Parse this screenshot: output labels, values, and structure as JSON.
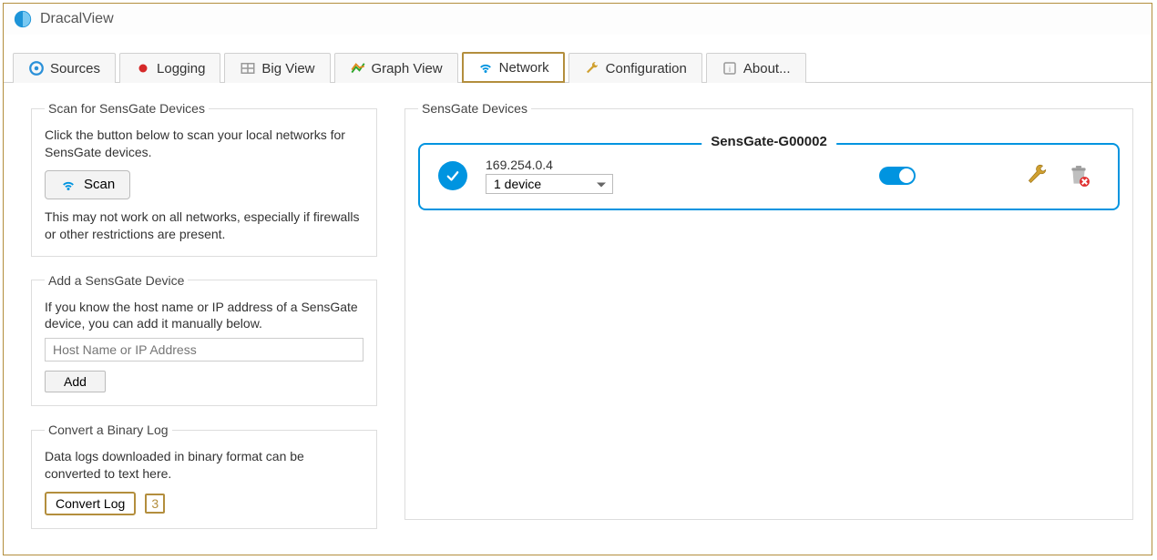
{
  "window": {
    "title": "DracalView"
  },
  "tabs": [
    {
      "label": "Sources",
      "icon": "gear-icon",
      "active": false
    },
    {
      "label": "Logging",
      "icon": "record-icon",
      "active": false
    },
    {
      "label": "Big View",
      "icon": "grid-icon",
      "active": false
    },
    {
      "label": "Graph View",
      "icon": "chart-icon",
      "active": false
    },
    {
      "label": "Network",
      "icon": "wifi-icon",
      "active": true,
      "highlight": true
    },
    {
      "label": "Configuration",
      "icon": "wrench-icon",
      "active": false
    },
    {
      "label": "About...",
      "icon": "info-icon",
      "active": false
    }
  ],
  "scan": {
    "legend": "Scan for SensGate Devices",
    "desc1": "Click the button below to scan your local networks for SensGate devices.",
    "button": "Scan",
    "desc2": "This may not work on all networks, especially if firewalls or other restrictions are present."
  },
  "add": {
    "legend": "Add a SensGate Device",
    "desc": "If you know the host name or IP address of a SensGate device, you can add it manually below.",
    "placeholder": "Host Name or IP Address",
    "button": "Add"
  },
  "convert": {
    "legend": "Convert a Binary Log",
    "desc": "Data logs downloaded in binary format can be converted to text here.",
    "button": "Convert Log",
    "annotation": "3"
  },
  "devices": {
    "legend": "SensGate Devices",
    "card": {
      "title": "SensGate-G00002",
      "ip": "169.254.0.4",
      "select": "1 device",
      "enabled": true
    }
  }
}
